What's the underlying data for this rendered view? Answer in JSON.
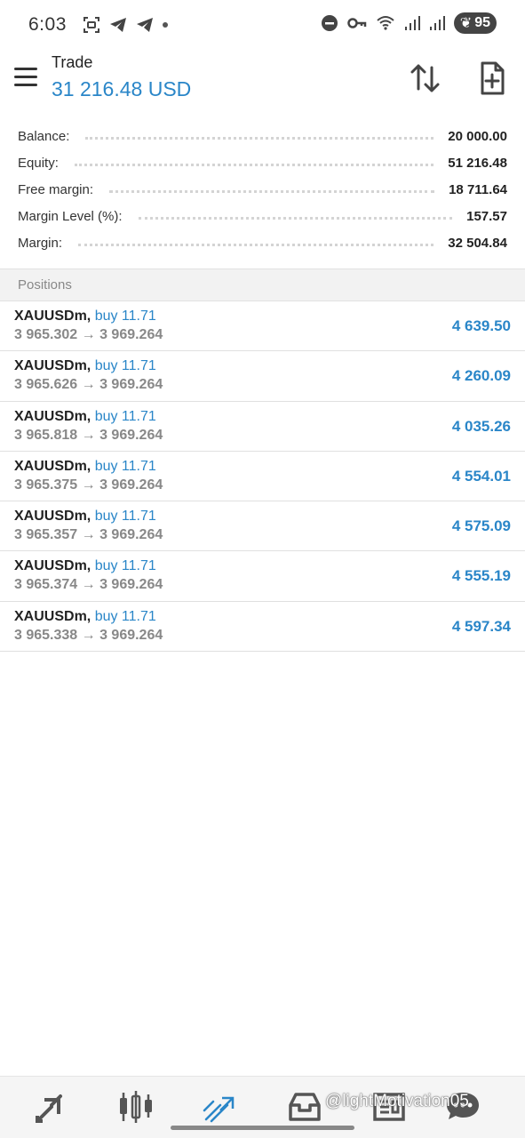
{
  "status_bar": {
    "time": "6:03",
    "battery": "95",
    "icons": [
      "screenshot-icon",
      "telegram-icon",
      "telegram-icon",
      "dot-icon",
      "dnd-icon",
      "key-icon",
      "wifi-icon",
      "signal-icon",
      "signal-icon",
      "battery-icon"
    ]
  },
  "header": {
    "title": "Trade",
    "balance_display": "31 216.48 USD"
  },
  "summary": [
    {
      "label": "Balance:",
      "value": "20 000.00"
    },
    {
      "label": "Equity:",
      "value": "51 216.48"
    },
    {
      "label": "Free margin:",
      "value": "18 711.64"
    },
    {
      "label": "Margin Level (%):",
      "value": "157.57"
    },
    {
      "label": "Margin:",
      "value": "32 504.84"
    }
  ],
  "positions_header": "Positions",
  "positions": [
    {
      "symbol": "XAUUSDm,",
      "side": "buy 11.71",
      "prices": "3 965.302 → 3 969.264",
      "profit": "4 639.50"
    },
    {
      "symbol": "XAUUSDm,",
      "side": "buy 11.71",
      "prices": "3 965.626 → 3 969.264",
      "profit": "4 260.09"
    },
    {
      "symbol": "XAUUSDm,",
      "side": "buy 11.71",
      "prices": "3 965.818 → 3 969.264",
      "profit": "4 035.26"
    },
    {
      "symbol": "XAUUSDm,",
      "side": "buy 11.71",
      "prices": "3 965.375 → 3 969.264",
      "profit": "4 554.01"
    },
    {
      "symbol": "XAUUSDm,",
      "side": "buy 11.71",
      "prices": "3 965.357 → 3 969.264",
      "profit": "4 575.09"
    },
    {
      "symbol": "XAUUSDm,",
      "side": "buy 11.71",
      "prices": "3 965.374 → 3 969.264",
      "profit": "4 555.19"
    },
    {
      "symbol": "XAUUSDm,",
      "side": "buy 11.71",
      "prices": "3 965.338 → 3 969.264",
      "profit": "4 597.34"
    }
  ],
  "bottom_nav": {
    "items": [
      "quotes-icon",
      "chart-icon",
      "trade-icon",
      "history-icon",
      "news-icon",
      "chat-icon"
    ],
    "active": "trade-icon",
    "watermark": "@lightMotivation05"
  },
  "colors": {
    "accent": "#2a86c8",
    "text": "#222222",
    "muted": "#888888"
  }
}
